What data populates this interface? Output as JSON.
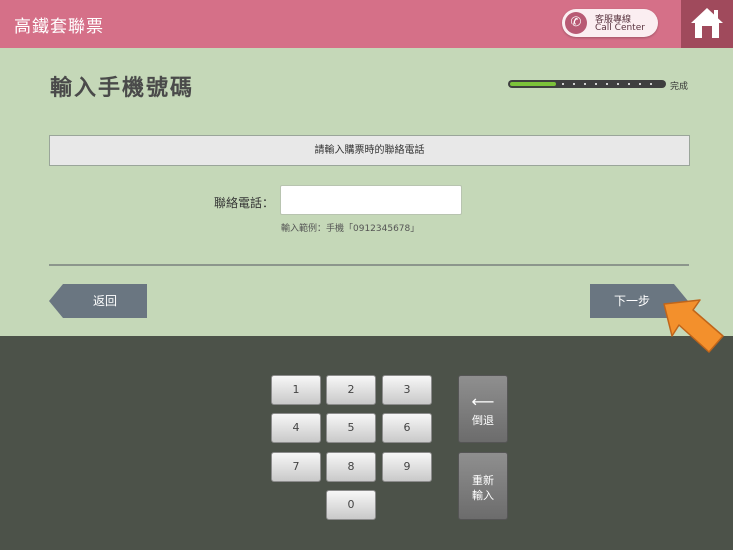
{
  "header": {
    "app_title": "高鐵套聯票",
    "call_center": {
      "line1": "客服專線",
      "line2": "Call Center",
      "icon": "phone-icon"
    },
    "home_icon": "home-icon",
    "color": "#d57088"
  },
  "page": {
    "title": "輸入手機號碼",
    "progress": {
      "fraction": 0.3,
      "label": "完成"
    }
  },
  "notice": "請輸入購票時的聯絡電話",
  "form": {
    "phone_label": "聯絡電話：",
    "phone_value": "",
    "phone_hint": "輸入範例：手機「0912345678」"
  },
  "nav": {
    "back_label": "返回",
    "next_label": "下一步",
    "pointer_icon": "arrow-pointer-icon"
  },
  "keypad": {
    "keys": [
      "1",
      "2",
      "3",
      "4",
      "5",
      "6",
      "7",
      "8",
      "9",
      "0"
    ],
    "backspace_label": "倒退",
    "reset_label": "重新輸入"
  }
}
